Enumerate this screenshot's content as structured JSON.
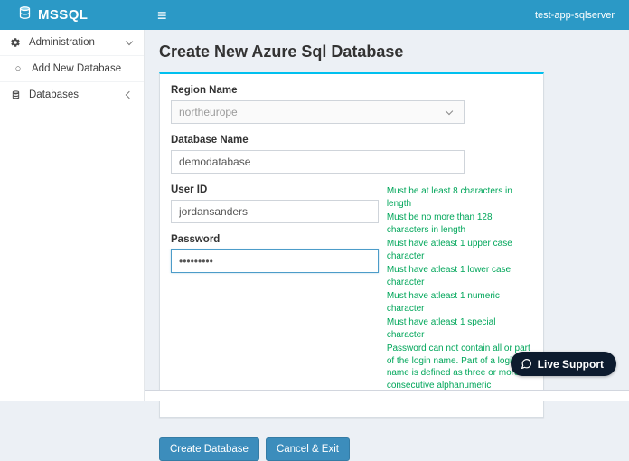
{
  "header": {
    "brand": "MSSQL",
    "server_name": "test-app-sqlserver"
  },
  "icons": {
    "menu": "≡",
    "circle": "○"
  },
  "sidebar": {
    "items": [
      {
        "label": "Administration"
      },
      {
        "label": "Add New Database"
      },
      {
        "label": "Databases"
      }
    ]
  },
  "page": {
    "title": "Create New Azure Sql Database"
  },
  "form": {
    "region": {
      "label": "Region Name",
      "value": "northeurope"
    },
    "database": {
      "label": "Database Name",
      "value": "demodatabase"
    },
    "user": {
      "label": "User ID",
      "value": "jordansanders"
    },
    "password": {
      "label": "Password",
      "value": "•••••••••"
    }
  },
  "validation": {
    "rules": [
      "Must be at least 8 characters in length",
      "Must be no more than 128 characters in length",
      "Must have atleast 1 upper case character",
      "Must have atleast 1 lower case character",
      "Must have atleast 1 numeric character",
      "Must have atleast 1 special character",
      "Password can not contain all or part of the login name. Part of a login name is defined as three or more consecutive alphanumeric characters"
    ]
  },
  "buttons": {
    "create": "Create Database",
    "cancel": "Cancel & Exit"
  },
  "live_support": {
    "label": "Live Support"
  },
  "colors": {
    "header_bg": "#2b99c6",
    "accent_cyan": "#00c0ef",
    "button_blue": "#3c8dbc",
    "validation_green": "#00a65a",
    "support_bg": "#0d1b2e"
  }
}
